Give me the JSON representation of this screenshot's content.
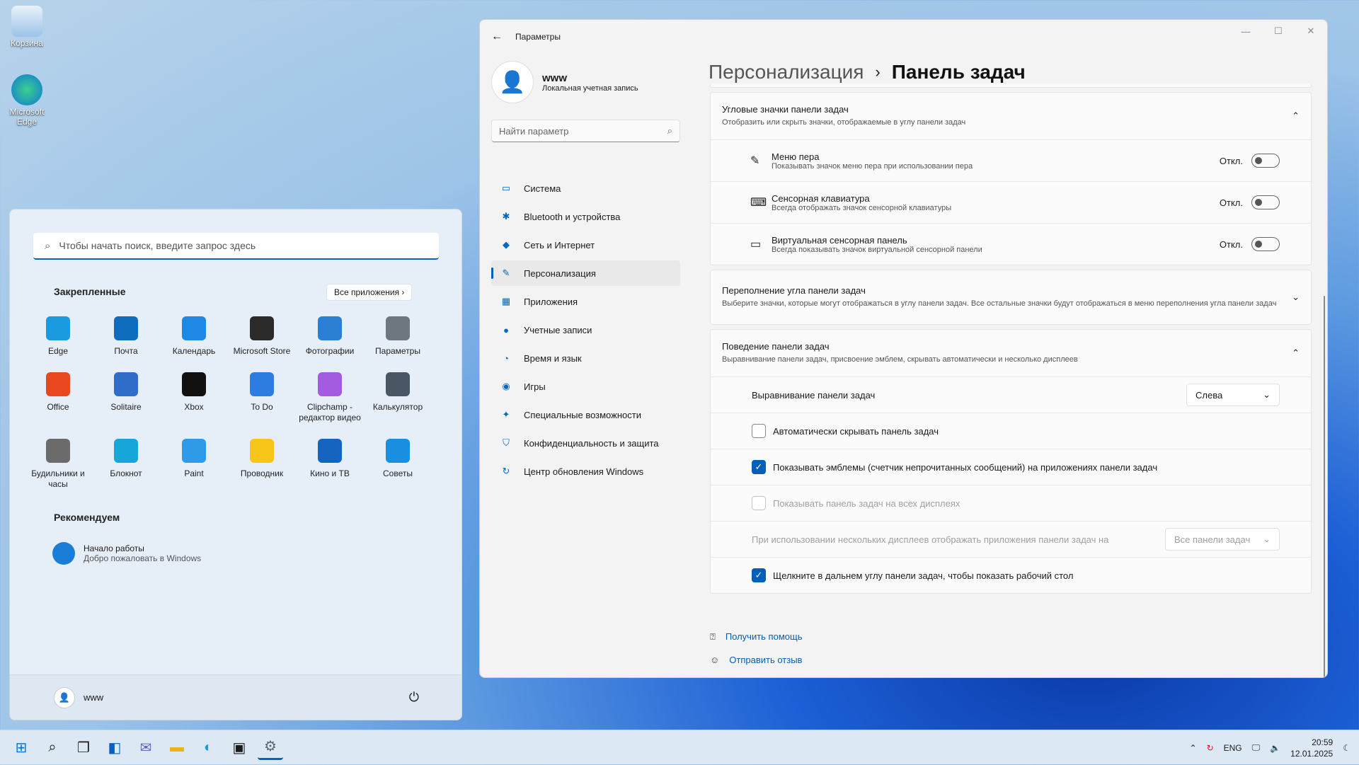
{
  "desktop": {
    "icons": [
      {
        "label": "Корзина"
      },
      {
        "label": "Microsoft Edge"
      }
    ]
  },
  "start": {
    "search_placeholder": "Чтобы начать поиск, введите запрос здесь",
    "pinned_title": "Закрепленные",
    "all_apps": "Все приложения",
    "apps": [
      {
        "label": "Edge",
        "color": "#1a9be0"
      },
      {
        "label": "Почта",
        "color": "#0f6cbd"
      },
      {
        "label": "Календарь",
        "color": "#1e88e5"
      },
      {
        "label": "Microsoft Store",
        "color": "#2b2b2b"
      },
      {
        "label": "Фотографии",
        "color": "#2a7fd4"
      },
      {
        "label": "Параметры",
        "color": "#6d7780"
      },
      {
        "label": "Office",
        "color": "#e8471f"
      },
      {
        "label": "Solitaire",
        "color": "#2e6ec9"
      },
      {
        "label": "Xbox",
        "color": "#111111"
      },
      {
        "label": "To Do",
        "color": "#2d7de0"
      },
      {
        "label": "Clipchamp - редактор видео",
        "color": "#a45be0"
      },
      {
        "label": "Калькулятор",
        "color": "#4a5663"
      },
      {
        "label": "Будильники и часы",
        "color": "#6b6b6b"
      },
      {
        "label": "Блокнот",
        "color": "#18a6d8"
      },
      {
        "label": "Paint",
        "color": "#2f9be8"
      },
      {
        "label": "Проводник",
        "color": "#f5c518"
      },
      {
        "label": "Кино и ТВ",
        "color": "#1565c0"
      },
      {
        "label": "Советы",
        "color": "#1a8fe0"
      }
    ],
    "recommended_title": "Рекомендуем",
    "recommended": [
      {
        "title": "Начало работы",
        "subtitle": "Добро пожаловать в Windows"
      }
    ],
    "user": "www"
  },
  "settings": {
    "window_title": "Параметры",
    "user": {
      "name": "www",
      "account": "Локальная учетная запись"
    },
    "search_placeholder": "Найти параметр",
    "nav": [
      {
        "label": "Система",
        "icon": "▭"
      },
      {
        "label": "Bluetooth и устройства",
        "icon": "✱"
      },
      {
        "label": "Сеть и Интернет",
        "icon": "◆"
      },
      {
        "label": "Персонализация",
        "icon": "✎"
      },
      {
        "label": "Приложения",
        "icon": "▦"
      },
      {
        "label": "Учетные записи",
        "icon": "●"
      },
      {
        "label": "Время и язык",
        "icon": "◔"
      },
      {
        "label": "Игры",
        "icon": "◉"
      },
      {
        "label": "Специальные возможности",
        "icon": "✦"
      },
      {
        "label": "Конфиденциальность и защита",
        "icon": "⛉"
      },
      {
        "label": "Центр обновления Windows",
        "icon": "↻"
      }
    ],
    "breadcrumb": {
      "parent": "Персонализация",
      "sep": "›",
      "current": "Панель задач"
    },
    "corner_icons": {
      "title": "Угловые значки панели задач",
      "desc": "Отобразить или скрыть значки, отображаемые в углу панели задач",
      "items": [
        {
          "title": "Меню пера",
          "desc": "Показывать значок меню пера при использовании пера",
          "state": "Откл."
        },
        {
          "title": "Сенсорная клавиатура",
          "desc": "Всегда отображать значок сенсорной клавиатуры",
          "state": "Откл."
        },
        {
          "title": "Виртуальная сенсорная панель",
          "desc": "Всегда показывать значок виртуальной сенсорной панели",
          "state": "Откл."
        }
      ]
    },
    "overflow": {
      "title": "Переполнение угла панели задач",
      "desc": "Выберите значки, которые могут отображаться в углу панели задач. Все остальные значки будут отображаться в меню переполнения угла панели задач"
    },
    "behavior": {
      "title": "Поведение панели задач",
      "desc": "Выравнивание панели задач, присвоение эмблем, скрывать автоматически и несколько дисплеев",
      "alignment_label": "Выравнивание панели задач",
      "alignment_value": "Слева",
      "auto_hide": "Автоматически скрывать панель задач",
      "badges": "Показывать эмблемы (счетчик непрочитанных сообщений) на приложениях панели задач",
      "all_displays": "Показывать панель задач на всех дисплеях",
      "multi_label": "При использовании нескольких дисплеев отображать приложения панели задач на",
      "multi_value": "Все панели задач",
      "far_corner": "Щелкните в дальнем углу панели задач, чтобы показать рабочий стол"
    },
    "links": {
      "help": "Получить помощь",
      "feedback": "Отправить отзыв"
    }
  },
  "taskbar": {
    "lang": "ENG",
    "time": "20:59",
    "date": "12.01.2025"
  }
}
